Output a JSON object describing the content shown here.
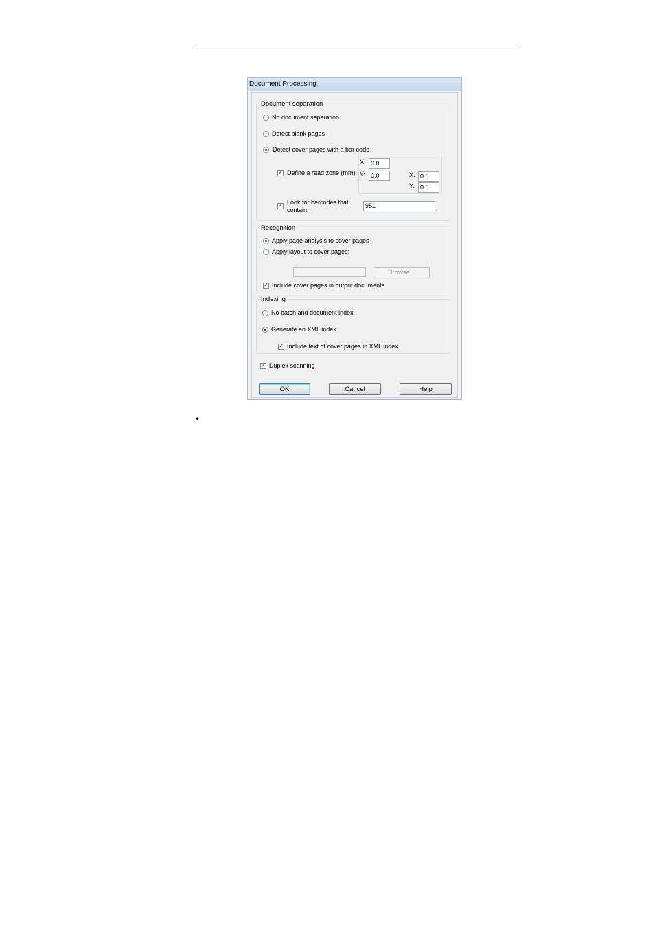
{
  "dialog": {
    "title": "Document Processing",
    "separation": {
      "legend": "Document separation",
      "option_none": "No document separation",
      "option_blank": "Detect blank pages",
      "option_cover": "Detect cover pages with a bar code",
      "selected": "option_cover",
      "read_zone_label": "Define a read zone (mm):",
      "read_zone_checked": true,
      "x_label": "X:",
      "y_label": "Y:",
      "x1": "0.0",
      "y1": "0.0",
      "x2": "0.0",
      "y2": "0.0",
      "barcode_label_line1": "Look for barcodes that",
      "barcode_label_line2": "contain:",
      "barcode_checked": true,
      "barcode_value": "951"
    },
    "recognition": {
      "legend": "Recognition",
      "option_analysis": "Apply page analysis to cover pages",
      "option_layout": "Apply layout to cover pages:",
      "selected": "option_analysis",
      "layout_path": "",
      "browse_label": "Browse...",
      "include_label": "Include cover pages in output documents",
      "include_checked": true
    },
    "indexing": {
      "legend": "Indexing",
      "option_none": "No batch and document index",
      "option_xml": "Generate an XML index",
      "selected": "option_xml",
      "include_text_label": "Include text of cover pages in XML index",
      "include_text_checked": true
    },
    "duplex_label": "Duplex scanning",
    "duplex_checked": true,
    "buttons": {
      "ok": "OK",
      "cancel": "Cancel",
      "help": "Help"
    }
  },
  "page": {
    "bullet": "•"
  }
}
